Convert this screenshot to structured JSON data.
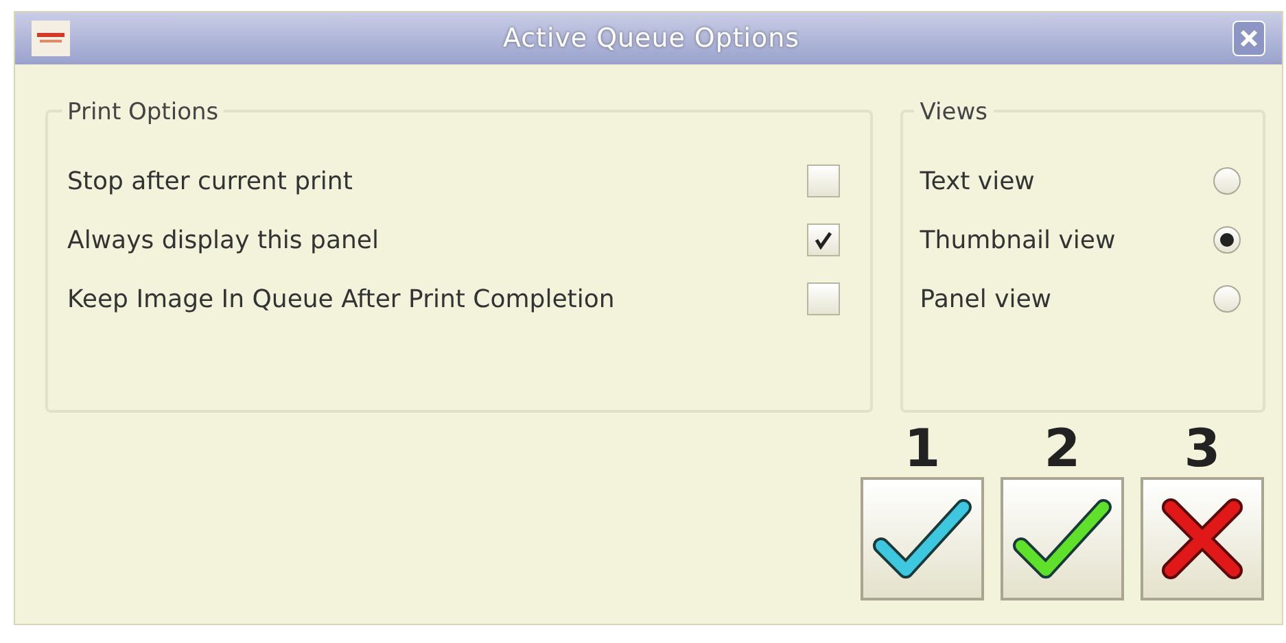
{
  "window": {
    "title": "Active Queue Options"
  },
  "print_options": {
    "title": "Print Options",
    "items": [
      {
        "label": "Stop after current print",
        "checked": false
      },
      {
        "label": "Always display this panel",
        "checked": true
      },
      {
        "label": "Keep Image In Queue After Print Completion",
        "checked": false
      }
    ]
  },
  "views": {
    "title": "Views",
    "items": [
      {
        "label": "Text view",
        "selected": false
      },
      {
        "label": "Thumbnail view",
        "selected": true
      },
      {
        "label": "Panel view",
        "selected": false
      }
    ]
  },
  "buttons": [
    {
      "number": "1",
      "kind": "check",
      "color": "#3ec8e0"
    },
    {
      "number": "2",
      "kind": "check",
      "color": "#5fe02a"
    },
    {
      "number": "3",
      "kind": "cross",
      "color": "#e01818"
    }
  ]
}
